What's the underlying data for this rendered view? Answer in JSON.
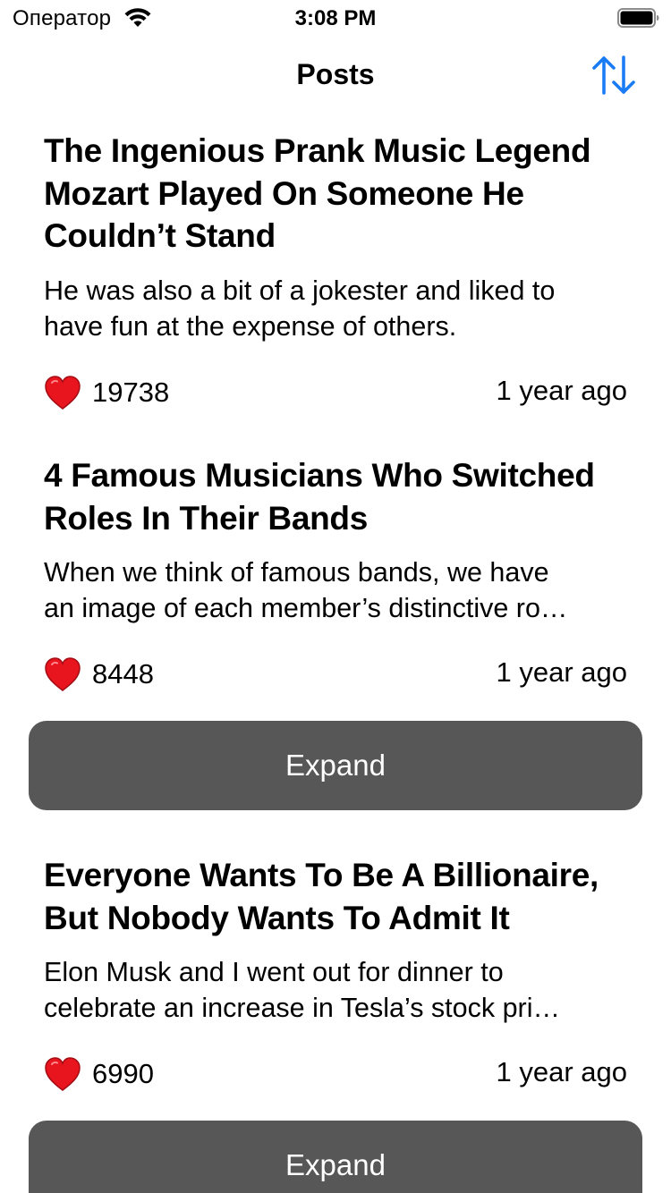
{
  "status_bar": {
    "carrier": "Оператор",
    "time": "3:08 PM"
  },
  "nav": {
    "title": "Posts",
    "sort_icon": "sort-arrows-icon",
    "accent_color": "#1a7cf5"
  },
  "posts": [
    {
      "title_lines": [
        "The Ingenious Prank Music Legend",
        "Mozart Played On Someone He",
        "Couldn’t Stand"
      ],
      "body_lines": [
        "He was also a bit of a jokester and liked to",
        "have fun at the expense of others."
      ],
      "likes": "19738",
      "time": "1 year ago"
    },
    {
      "title_lines": [
        "4 Famous Musicians Who Switched",
        "Roles In Their Bands"
      ],
      "body_lines": [
        "When we think of famous bands, we have",
        "an image of each member’s distinctive ro…"
      ],
      "likes": "8448",
      "time": "1 year ago",
      "expand_label": "Expand"
    },
    {
      "title_lines": [
        "Everyone Wants To Be A Billionaire,",
        "But Nobody Wants To Admit It"
      ],
      "body_lines": [
        "Elon Musk and I went out for dinner to",
        "celebrate an increase in Tesla’s stock pri…"
      ],
      "likes": "6990",
      "time": "1 year ago",
      "expand_label": "Expand"
    }
  ],
  "colors": {
    "heart": "#e8141e",
    "expand_button_bg": "#575757"
  }
}
